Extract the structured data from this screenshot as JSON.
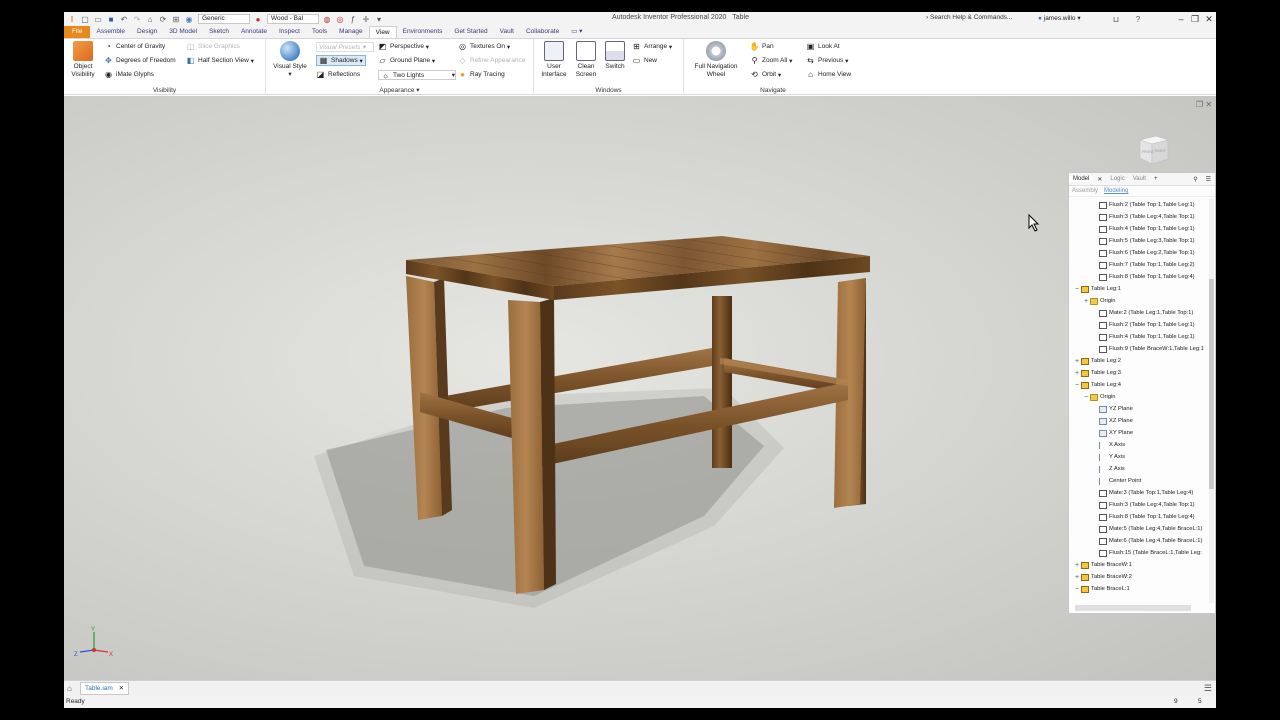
{
  "titlebar": {
    "app_title": "Autodesk Inventor Professional 2020",
    "document": "Table",
    "appearance_select": "Generic",
    "material_select": "Wood - Bal",
    "search_placeholder": "Search Help & Commands...",
    "user": "james.willo"
  },
  "tabs": [
    "File",
    "Assemble",
    "Design",
    "3D Model",
    "Sketch",
    "Annotate",
    "Inspect",
    "Tools",
    "Manage",
    "View",
    "Environments",
    "Get Started",
    "Vault",
    "Collaborate"
  ],
  "active_tab": "View",
  "ribbon": {
    "visibility": {
      "title": "Visibility",
      "object_visibility": "Object\nVisibility",
      "center_of_gravity": "Center of Gravity",
      "degrees_of_freedom": "Degrees of Freedom",
      "imate_glyphs": "iMate Glyphs",
      "slice_graphics": "Slice Graphics",
      "half_section_view": "Half Section View"
    },
    "appearance": {
      "title": "Appearance",
      "visual_style": "Visual Style",
      "visual_presets": "Visual Presets",
      "shadows": "Shadows",
      "reflections": "Reflections",
      "perspective": "Perspective",
      "ground_plane": "Ground Plane",
      "two_lights": "Two Lights",
      "textures_on": "Textures On",
      "refine_appearance": "Refine Appearance",
      "ray_tracing": "Ray Tracing"
    },
    "windows": {
      "title": "Windows",
      "user_interface": "User\nInterface",
      "clean_screen": "Clean\nScreen",
      "switch": "Switch",
      "arrange": "Arrange",
      "new": "New"
    },
    "navigate": {
      "title": "Navigate",
      "full_navigation_wheel": "Full Navigation\nWheel",
      "pan": "Pan",
      "zoom_all": "Zoom All",
      "orbit": "Orbit",
      "look_at": "Look At",
      "previous": "Previous",
      "home_view": "Home View"
    }
  },
  "viewcube": {
    "front": "FRONT",
    "right": "RIGHT"
  },
  "triad": {
    "x": "X",
    "y": "Y",
    "z": "Z"
  },
  "browser": {
    "tabs": [
      "Model",
      "Logic",
      "Vault"
    ],
    "sub_tabs": [
      "Assembly",
      "Modeling"
    ],
    "tree": [
      {
        "label": "Flush:2 (Table Top:1,Table Leg:1)",
        "indent": 2,
        "icon": "constraint"
      },
      {
        "label": "Flush:3 (Table Leg:4,Table Top:1)",
        "indent": 2,
        "icon": "constraint"
      },
      {
        "label": "Flush:4 (Table Top:1,Table Leg:1)",
        "indent": 2,
        "icon": "constraint"
      },
      {
        "label": "Flush:5 (Table Leg:3,Table Top:1)",
        "indent": 2,
        "icon": "constraint"
      },
      {
        "label": "Flush:6 (Table Leg:2,Table Top:1)",
        "indent": 2,
        "icon": "constraint"
      },
      {
        "label": "Flush:7 (Table Top:1,Table Leg:2)",
        "indent": 2,
        "icon": "constraint"
      },
      {
        "label": "Flush:8 (Table Top:1,Table Leg:4)",
        "indent": 2,
        "icon": "constraint"
      },
      {
        "label": "Table Leg:1",
        "indent": 0,
        "icon": "part",
        "exp": "−"
      },
      {
        "label": "Origin",
        "indent": 1,
        "icon": "folder",
        "exp": "+"
      },
      {
        "label": "Mate:2 (Table Leg:1,Table Top:1)",
        "indent": 2,
        "icon": "constraint"
      },
      {
        "label": "Flush:2 (Table Top:1,Table Leg:1)",
        "indent": 2,
        "icon": "constraint"
      },
      {
        "label": "Flush:4 (Table Top:1,Table Leg:1)",
        "indent": 2,
        "icon": "constraint"
      },
      {
        "label": "Flush:9 (Table BraceW:1,Table Leg:1",
        "indent": 2,
        "icon": "constraint"
      },
      {
        "label": "Table Leg:2",
        "indent": 0,
        "icon": "part",
        "exp": "+"
      },
      {
        "label": "Table Leg:3",
        "indent": 0,
        "icon": "part",
        "exp": "+"
      },
      {
        "label": "Table Leg:4",
        "indent": 0,
        "icon": "part",
        "exp": "−"
      },
      {
        "label": "Origin",
        "indent": 1,
        "icon": "folder",
        "exp": "−"
      },
      {
        "label": "YZ Plane",
        "indent": 2,
        "icon": "plane"
      },
      {
        "label": "XZ Plane",
        "indent": 2,
        "icon": "plane"
      },
      {
        "label": "XY Plane",
        "indent": 2,
        "icon": "plane"
      },
      {
        "label": "X Axis",
        "indent": 2,
        "icon": "axis"
      },
      {
        "label": "Y Axis",
        "indent": 2,
        "icon": "axis"
      },
      {
        "label": "Z Axis",
        "indent": 2,
        "icon": "axis"
      },
      {
        "label": "Center Point",
        "indent": 2,
        "icon": "axis"
      },
      {
        "label": "Mate:3 (Table Top:1,Table Leg:4)",
        "indent": 2,
        "icon": "constraint"
      },
      {
        "label": "Flush:3 (Table Leg:4,Table Top:1)",
        "indent": 2,
        "icon": "constraint"
      },
      {
        "label": "Flush:8 (Table Top:1,Table Leg:4)",
        "indent": 2,
        "icon": "constraint"
      },
      {
        "label": "Mate:5 (Table Leg:4,Table BraceL:1)",
        "indent": 2,
        "icon": "constraint"
      },
      {
        "label": "Mate:6 (Table Leg:4,Table BraceL:1)",
        "indent": 2,
        "icon": "constraint"
      },
      {
        "label": "Flush:15 (Table BraceL:1,Table Leg:",
        "indent": 2,
        "icon": "constraint"
      },
      {
        "label": "Table BraceW:1",
        "indent": 0,
        "icon": "part",
        "exp": "+"
      },
      {
        "label": "Table BraceW:2",
        "indent": 0,
        "icon": "part",
        "exp": "+"
      },
      {
        "label": "Table BraceL:1",
        "indent": 0,
        "icon": "part",
        "exp": "−"
      }
    ]
  },
  "doc_tab": "Table.iam",
  "status": {
    "text": "Ready",
    "n1": "9",
    "n2": "5"
  }
}
